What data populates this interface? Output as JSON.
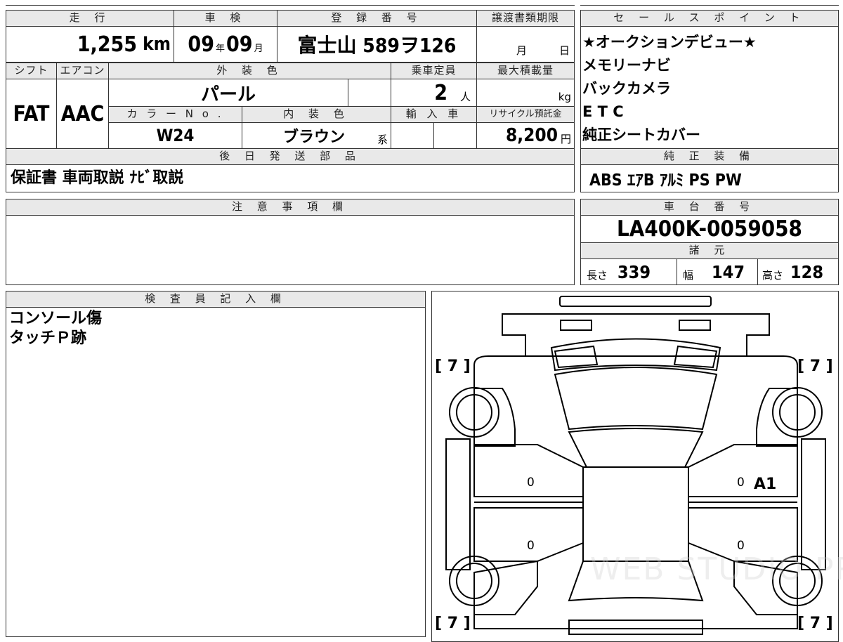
{
  "header": {
    "mileage_label": "走 行",
    "shaken_label": "車 検",
    "registration_label": "登 録 番 号",
    "transfer_deadline_label": "譲渡書類期限"
  },
  "values": {
    "mileage": "1,255",
    "mileage_unit": "km",
    "shaken_year": "09",
    "shaken_year_unit": "年",
    "shaken_month": "09",
    "shaken_month_unit": "月",
    "registration": "富士山 589ヲ126",
    "transfer_month_unit": "月",
    "transfer_day_unit": "日"
  },
  "row2": {
    "shift_label": "シフト",
    "ac_label": "エアコン",
    "exterior_label": "外 装 色",
    "capacity_label": "乗車定員",
    "max_load_label": "最大積載量",
    "shift": "FAT",
    "ac": "AAC",
    "exterior_color": "パール",
    "capacity": "2",
    "capacity_unit": "人",
    "max_load_unit": "kg"
  },
  "row3": {
    "color_no_label": "カ ラ ー N o .",
    "interior_label": "内 装 色",
    "import_label": "輸 入 車",
    "recycle_label": "リサイクル預託金",
    "color_no": "W24",
    "interior_color": "ブラウン",
    "interior_suffix": "系",
    "recycle_fee": "8,200",
    "recycle_unit": "円"
  },
  "later_parts": {
    "label": "後 日 発 送 部 品",
    "value": "保証書 車両取説 ﾅﾋﾞ取説"
  },
  "sales_points": {
    "label": "セ ー ル ス ポ イ ン ト",
    "items": [
      "★オークションデビュー★",
      "メモリーナビ",
      "バックカメラ",
      "E T C",
      "純正シートカバー"
    ]
  },
  "equipment": {
    "label": "純 正 装 備",
    "value": "ABS ｴｱB ｱﾙﾐ PS PW"
  },
  "notes": {
    "label": "注 意 事 項 欄"
  },
  "chassis": {
    "label": "車 台 番 号",
    "value": "LA400K-0059058"
  },
  "specs": {
    "label": "諸 元",
    "length_label": "長さ",
    "length": "339",
    "width_label": "幅",
    "width": "147",
    "height_label": "高さ",
    "height": "128"
  },
  "inspector": {
    "label": "検 査 員 記 入 欄",
    "lines": [
      "コンソール傷",
      "タッチＰ跡"
    ]
  },
  "diagram": {
    "tire_tl": "[ 7 ]",
    "tire_tr": "[ 7 ]",
    "tire_bl": "[ 7 ]",
    "tire_br": "[ 7 ]",
    "door_fl": "0",
    "door_fr": "0",
    "door_rl": "0",
    "door_rr": "0",
    "damage_fr": "A1"
  },
  "watermark": "WEB STUDIO PRO"
}
